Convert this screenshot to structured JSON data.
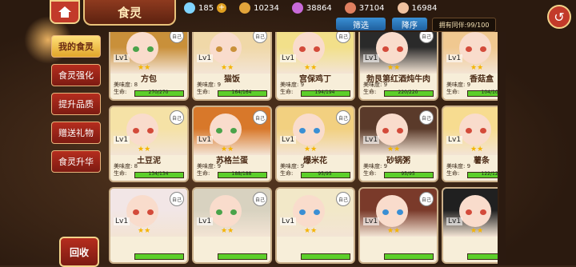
{
  "header": {
    "title": "食灵",
    "resources": [
      {
        "icon": "diamond-icon",
        "value": "185",
        "plus": "+"
      },
      {
        "icon": "coin-bag-icon",
        "value": "10234"
      },
      {
        "icon": "gem-icon",
        "value": "38864"
      },
      {
        "icon": "meat-icon",
        "value": "37104"
      },
      {
        "icon": "shell-icon",
        "value": "16984"
      }
    ]
  },
  "filter": {
    "label": "筛选"
  },
  "sort": {
    "label": "降序"
  },
  "owned": {
    "label": "拥有同伴:99/100"
  },
  "sidebar": {
    "items": [
      {
        "label": "我的食灵",
        "active": true
      },
      {
        "label": "食灵强化",
        "active": false
      },
      {
        "label": "提升品质",
        "active": false
      },
      {
        "label": "赠送礼物",
        "active": false
      },
      {
        "label": "食灵升华",
        "active": false
      }
    ],
    "recycle": "回收"
  },
  "cards": [
    {
      "name": "方包",
      "lvl": "Lv1",
      "stars": "★★",
      "taste": "美味度: 8",
      "hp": "生命:",
      "hp_text": "270/270",
      "hp_frac": 1.0,
      "hair": "#c9903a",
      "eye": "#4aa34a",
      "badge": "自己"
    },
    {
      "name": "猫饭",
      "lvl": "Lv1",
      "stars": "★★",
      "taste": "美味度: 9",
      "hp": "生命:",
      "hp_text": "164/164",
      "hp_frac": 1.0,
      "hair": "#f0d8a8",
      "eye": "#c9903a",
      "badge": "自己"
    },
    {
      "name": "宫保鸡丁",
      "lvl": "Lv1",
      "stars": "★★",
      "taste": "美味度: 9",
      "hp": "生命:",
      "hp_text": "194/194",
      "hp_frac": 1.0,
      "hair": "#f2e08a",
      "eye": "#d34a3a",
      "badge": "自己"
    },
    {
      "name": "勃艮第红酒炖牛肉",
      "lvl": "Lv1",
      "stars": "★★",
      "taste": "美味度: 9",
      "hp": "生命:",
      "hp_text": "220/220",
      "hp_frac": 1.0,
      "hair": "#2a2a2a",
      "eye": "#d34a3a",
      "badge": "自己"
    },
    {
      "name": "香菇盒",
      "lvl": "Lv1",
      "stars": "★★",
      "taste": "美味度: 9",
      "hp": "生命:",
      "hp_text": "104/104",
      "hp_frac": 1.0,
      "hair": "#f0c890",
      "eye": "#d34a3a",
      "badge": "自己"
    },
    {
      "name": "土豆泥",
      "lvl": "Lv1",
      "stars": "★★",
      "taste": "美味度: 8",
      "hp": "生命:",
      "hp_text": "134/134",
      "hp_frac": 1.0,
      "hair": "#f5e2a6",
      "eye": "#d34a3a",
      "badge": "自己"
    },
    {
      "name": "苏格兰蛋",
      "lvl": "Lv1",
      "stars": "★★",
      "taste": "美味度: 9",
      "hp": "生命:",
      "hp_text": "188/188",
      "hp_frac": 1.0,
      "hair": "#d8782a",
      "eye": "#4aa34a",
      "badge": "自己"
    },
    {
      "name": "爆米花",
      "lvl": "Lv1",
      "stars": "★★",
      "taste": "美味度: 9",
      "hp": "生命:",
      "hp_text": "95/95",
      "hp_frac": 1.0,
      "hair": "#f2d080",
      "eye": "#3a8fd4",
      "badge": "自己"
    },
    {
      "name": "砂锅粥",
      "lvl": "Lv1",
      "stars": "★★",
      "taste": "美味度: 9",
      "hp": "生命:",
      "hp_text": "95/95",
      "hp_frac": 1.0,
      "hair": "#5a3a2a",
      "eye": "#d34a3a",
      "badge": "自己"
    },
    {
      "name": "薯条",
      "lvl": "Lv1",
      "stars": "★★",
      "taste": "美味度: 9",
      "hp": "生命:",
      "hp_text": "122/122",
      "hp_frac": 1.0,
      "hair": "#f7dc90",
      "eye": "#d34a3a",
      "badge": "自己"
    },
    {
      "name": "",
      "lvl": "Lv1",
      "stars": "★★",
      "taste": "",
      "hp": "",
      "hp_text": "",
      "hp_frac": 1.0,
      "hair": "#f2e6e6",
      "eye": "#d34a3a",
      "badge": "自己"
    },
    {
      "name": "",
      "lvl": "Lv1",
      "stars": "★★",
      "taste": "",
      "hp": "",
      "hp_text": "",
      "hp_frac": 1.0,
      "hair": "#d8d2c0",
      "eye": "#4aa34a",
      "badge": "自己"
    },
    {
      "name": "",
      "lvl": "Lv1",
      "stars": "★★",
      "taste": "",
      "hp": "",
      "hp_text": "",
      "hp_frac": 1.0,
      "hair": "#f2e8c8",
      "eye": "#3a8fd4",
      "badge": "自己"
    },
    {
      "name": "",
      "lvl": "Lv1",
      "stars": "★★",
      "taste": "",
      "hp": "",
      "hp_text": "",
      "hp_frac": 1.0,
      "hair": "#7a3a2a",
      "eye": "#3a8fd4",
      "badge": "自己"
    },
    {
      "name": "",
      "lvl": "Lv1",
      "stars": "★★",
      "taste": "",
      "hp": "",
      "hp_text": "",
      "hp_frac": 1.0,
      "hair": "#202020",
      "eye": "#d34a3a",
      "badge": "自己"
    }
  ]
}
